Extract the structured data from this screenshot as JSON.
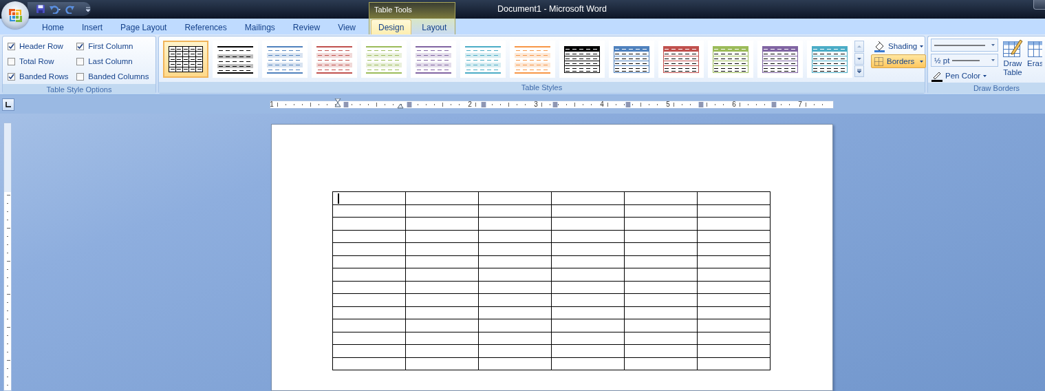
{
  "window": {
    "title": "Document1 - Microsoft Word"
  },
  "tabs": [
    {
      "label": "Home",
      "selected": false
    },
    {
      "label": "Insert",
      "selected": false
    },
    {
      "label": "Page Layout",
      "selected": false
    },
    {
      "label": "References",
      "selected": false
    },
    {
      "label": "Mailings",
      "selected": false
    },
    {
      "label": "Review",
      "selected": false
    },
    {
      "label": "View",
      "selected": false
    }
  ],
  "contextual_tabs": {
    "label": "Table Tools",
    "tabs": [
      {
        "label": "Design",
        "selected": true
      },
      {
        "label": "Layout",
        "selected": false
      }
    ]
  },
  "table_style_options": {
    "label": "Table Style Options",
    "options": [
      {
        "label": "Header Row",
        "checked": true
      },
      {
        "label": "Total Row",
        "checked": false
      },
      {
        "label": "Banded Rows",
        "checked": true
      },
      {
        "label": "First Column",
        "checked": true
      },
      {
        "label": "Last Column",
        "checked": false
      },
      {
        "label": "Banded Columns",
        "checked": false
      }
    ]
  },
  "table_styles": {
    "label": "Table Styles",
    "items": [
      {
        "kind": "grid",
        "color": "#000000",
        "selected": true
      },
      {
        "kind": "banded",
        "color": "#000000",
        "selected": false
      },
      {
        "kind": "light",
        "color": "#4f81bd",
        "selected": false
      },
      {
        "kind": "light",
        "color": "#c0504d",
        "selected": false
      },
      {
        "kind": "light",
        "color": "#9bbb59",
        "selected": false
      },
      {
        "kind": "light",
        "color": "#8064a2",
        "selected": false
      },
      {
        "kind": "light",
        "color": "#4bacc6",
        "selected": false
      },
      {
        "kind": "light",
        "color": "#f79646",
        "selected": false
      },
      {
        "kind": "header",
        "color": "#000000",
        "selected": false
      },
      {
        "kind": "header",
        "color": "#4f81bd",
        "selected": false
      },
      {
        "kind": "header",
        "color": "#c0504d",
        "selected": false
      },
      {
        "kind": "header",
        "color": "#9bbb59",
        "selected": false
      },
      {
        "kind": "header",
        "color": "#8064a2",
        "selected": false
      },
      {
        "kind": "header",
        "color": "#4bacc6",
        "selected": false
      }
    ],
    "shading": "Shading",
    "borders": "Borders"
  },
  "draw_borders": {
    "label": "Draw Borders",
    "line_weight": "½ pt",
    "pen_color": "Pen Color",
    "draw_table": "Draw Table",
    "eraser": "Eras"
  },
  "ruler": {
    "numbers": [
      "1",
      "2",
      "3",
      "4",
      "5",
      "6",
      "7"
    ]
  }
}
